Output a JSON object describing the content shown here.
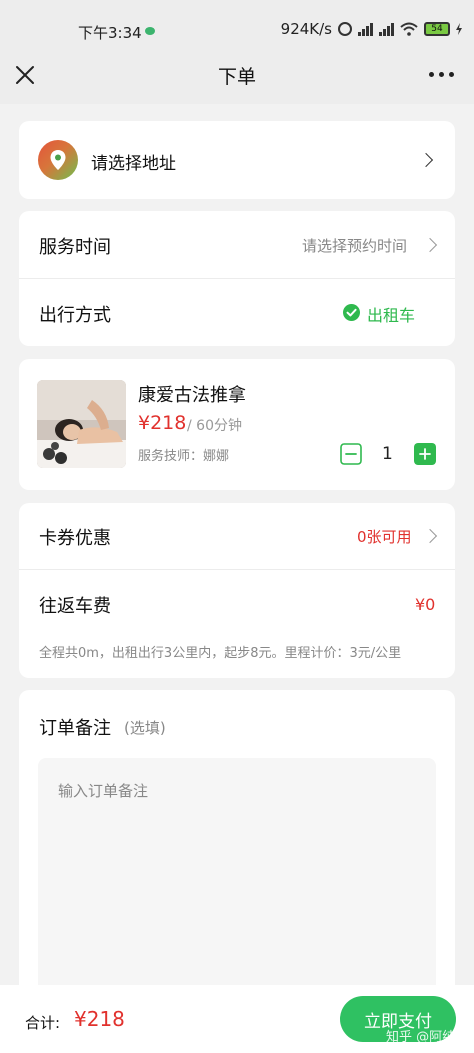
{
  "status_bar": {
    "time": "下午3:34",
    "network_speed": "924K/s",
    "battery": "54"
  },
  "nav": {
    "title": "下单"
  },
  "address": {
    "placeholder_text": "请选择地址"
  },
  "service": {
    "time_label": "服务时间",
    "time_value": "请选择预约时间",
    "travel_label": "出行方式",
    "travel_value": "出租车"
  },
  "product": {
    "name": "康爱古法推拿",
    "price": "¥218",
    "duration": "/ 60分钟",
    "technician": "服务技师：娜娜",
    "quantity": "1"
  },
  "coupon": {
    "label": "卡券优惠",
    "value": "0张可用"
  },
  "fare": {
    "label": "往返车费",
    "value": "¥0",
    "note": "全程共0m，出租出行3公里内，起步8元。里程计价：3元/公里"
  },
  "remark": {
    "label": "订单备注",
    "optional": "(选填)",
    "placeholder": "输入订单备注"
  },
  "footer": {
    "total_label": "合计:",
    "total_value": "¥218",
    "pay_label": "立即支付",
    "watermark": "知乎 @阿纯V"
  },
  "colors": {
    "accent_green": "#2fc162",
    "price_red": "#e1312d"
  }
}
